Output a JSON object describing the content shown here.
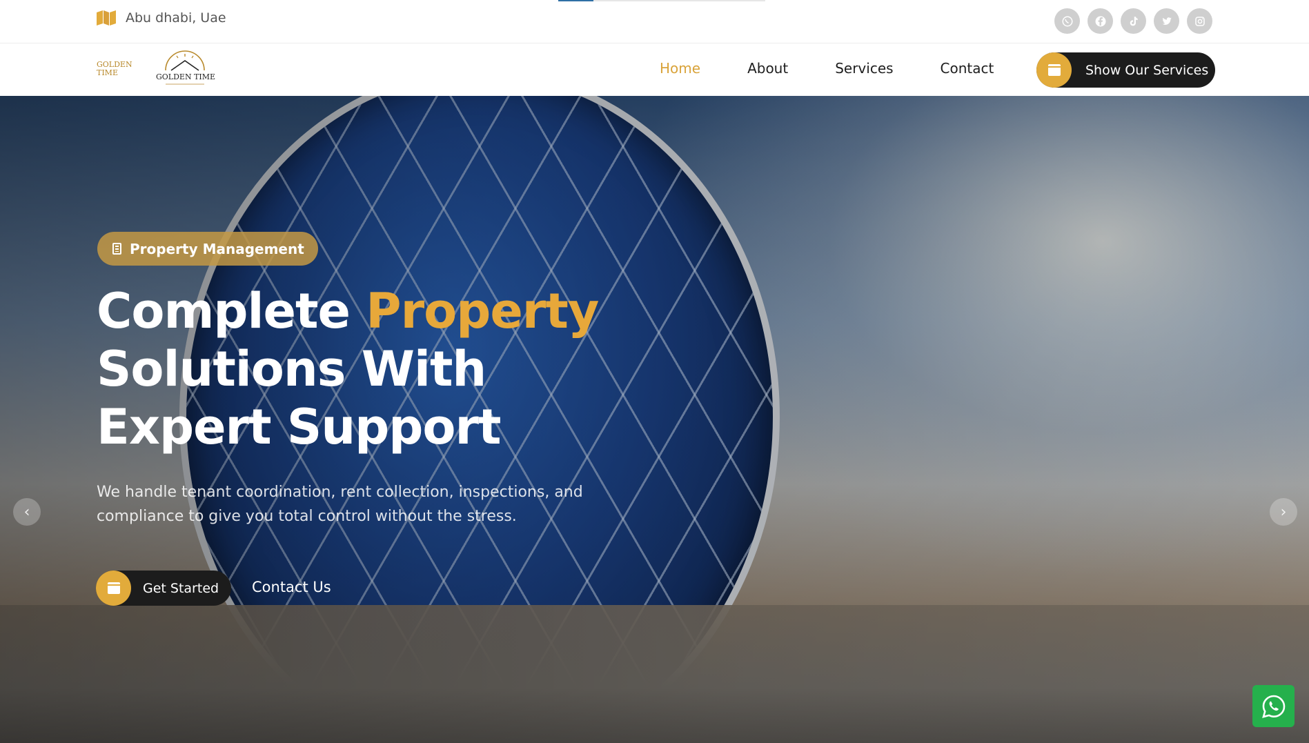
{
  "topbar": {
    "location": "Abu dhabi, Uae",
    "loading_progress": 0.17,
    "socials": [
      {
        "icon": "whatsapp-icon"
      },
      {
        "icon": "facebook-icon"
      },
      {
        "icon": "tiktok-icon"
      },
      {
        "icon": "twitter-icon"
      },
      {
        "icon": "instagram-icon"
      }
    ]
  },
  "logo": {
    "left_text": "GOLDEN TIME",
    "right_text": "GOLDEN TIME"
  },
  "nav": {
    "items": [
      {
        "label": "Home",
        "active": true
      },
      {
        "label": "About",
        "active": false
      },
      {
        "label": "Services",
        "active": false
      },
      {
        "label": "Contact",
        "active": false
      }
    ],
    "cta_label": "Show Our Services"
  },
  "hero": {
    "tag": "Property Management",
    "title_part1": "Complete ",
    "title_accent": "Property",
    "title_part2": "Solutions With Expert Support",
    "description": "We handle tenant coordination, rent collection, inspections, and compliance to give you total control without the stress.",
    "primary_button": "Get Started",
    "secondary_link": "Contact Us",
    "prev_arrow": "‹",
    "next_arrow": "›"
  },
  "colors": {
    "accent": "#e2ab3b",
    "dark": "#1c1c1c",
    "whatsapp": "#25b04c"
  }
}
